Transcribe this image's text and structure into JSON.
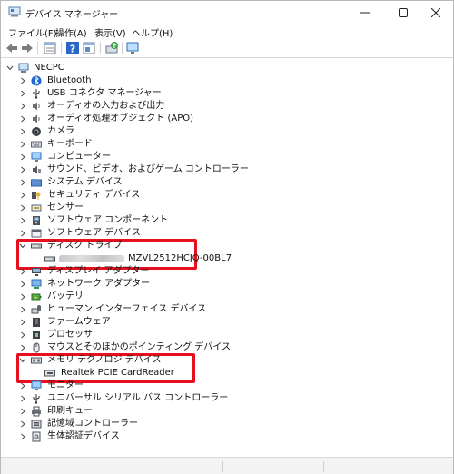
{
  "window": {
    "title": "デバイス マネージャー",
    "icons": {
      "app": "device-manager-icon",
      "minimize": "minimize-icon",
      "maximize": "maximize-icon",
      "close": "close-icon"
    }
  },
  "menu": [
    {
      "label": "ファイル(F)"
    },
    {
      "label": "操作(A)"
    },
    {
      "label": "表示(V)"
    },
    {
      "label": "ヘルプ(H)"
    }
  ],
  "toolbar": [
    "back-arrow-icon",
    "forward-arrow-icon",
    "properties-icon",
    "help-icon",
    "window-icon",
    "update-driver-icon",
    "monitor-icon"
  ],
  "tree": {
    "root": "NECPC",
    "categories": [
      {
        "label": "Bluetooth",
        "icon": "bluetooth-icon"
      },
      {
        "label": "USB コネクタ マネージャー",
        "icon": "usb-icon"
      },
      {
        "label": "オーディオの入力および出力",
        "icon": "speaker-icon"
      },
      {
        "label": "オーディオ処理オブジェクト (APO)",
        "icon": "speaker-icon"
      },
      {
        "label": "カメラ",
        "icon": "camera-icon"
      },
      {
        "label": "キーボード",
        "icon": "keyboard-icon"
      },
      {
        "label": "コンピューター",
        "icon": "computer-icon"
      },
      {
        "label": "サウンド、ビデオ、およびゲーム コントローラー",
        "icon": "sound-icon"
      },
      {
        "label": "システム デバイス",
        "icon": "system-folder-icon"
      },
      {
        "label": "セキュリティ デバイス",
        "icon": "security-key-icon"
      },
      {
        "label": "センサー",
        "icon": "sensor-icon"
      },
      {
        "label": "ソフトウェア コンポーネント",
        "icon": "software-component-icon"
      },
      {
        "label": "ソフトウェア デバイス",
        "icon": "software-device-icon"
      },
      {
        "label": "ディスク ドライブ",
        "icon": "disk-drive-icon",
        "expanded": true,
        "children": [
          {
            "label": "MZVL2512HCJQ-00BL7",
            "icon": "disk-drive-icon"
          }
        ]
      },
      {
        "label": "ディスプレイ アダプター",
        "icon": "display-adapter-icon"
      },
      {
        "label": "ネットワーク アダプター",
        "icon": "network-adapter-icon"
      },
      {
        "label": "バッテリ",
        "icon": "battery-icon"
      },
      {
        "label": "ヒューマン インターフェイス デバイス",
        "icon": "hid-icon"
      },
      {
        "label": "ファームウェア",
        "icon": "firmware-icon"
      },
      {
        "label": "プロセッサ",
        "icon": "processor-icon"
      },
      {
        "label": "マウスとそのほかのポインティング デバイス",
        "icon": "mouse-icon"
      },
      {
        "label": "メモリ テクノロジ デバイス",
        "icon": "memory-technology-icon",
        "expanded": true,
        "children": [
          {
            "label": "Realtek PCIE CardReader",
            "icon": "card-reader-icon"
          }
        ]
      },
      {
        "label": "モニター",
        "icon": "monitor-icon"
      },
      {
        "label": "ユニバーサル シリアル バス コントローラー",
        "icon": "usb-controller-icon"
      },
      {
        "label": "印刷キュー",
        "icon": "printer-icon"
      },
      {
        "label": "記憶域コントローラー",
        "icon": "storage-controller-icon"
      },
      {
        "label": "生体認証デバイス",
        "icon": "biometric-icon"
      }
    ]
  },
  "colors": {
    "highlight_box": "#e8101e",
    "accent_blue": "#1f6fd1"
  }
}
